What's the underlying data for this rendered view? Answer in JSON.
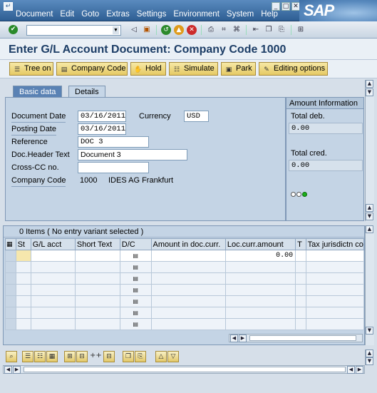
{
  "menubar": {
    "system_icon": "app-menu-icon",
    "items": [
      "Document",
      "Edit",
      "Goto",
      "Extras",
      "Settings",
      "Environment",
      "System",
      "Help"
    ],
    "logo": "SAP"
  },
  "toolbar": {
    "command_value": "",
    "icons": [
      "enter-icon",
      "back-nav-icon",
      "save-icon",
      "back-icon",
      "exit-icon",
      "cancel-icon",
      "print-icon",
      "find-icon",
      "find-next-icon",
      "first-page-icon",
      "create-session-icon",
      "generate-shortcut-icon",
      "layout-menu-icon"
    ]
  },
  "title": "Enter G/L Account Document: Company Code 1000",
  "app_toolbar": {
    "buttons": [
      {
        "label": "Tree on",
        "icon": "tree-icon"
      },
      {
        "label": "Company Code",
        "icon": "company-code-icon"
      },
      {
        "label": "Hold",
        "icon": "hold-icon"
      },
      {
        "label": "Simulate",
        "icon": "simulate-icon"
      },
      {
        "label": "Park",
        "icon": "park-icon"
      },
      {
        "label": "Editing options",
        "icon": "pencil-icon"
      }
    ]
  },
  "tabs": {
    "basic": "Basic data",
    "details": "Details"
  },
  "form": {
    "document_date_label": "Document Date",
    "document_date": "03/16/2011",
    "currency_label": "Currency",
    "currency": "USD",
    "posting_date_label": "Posting Date",
    "posting_date": "03/16/2011",
    "reference_label": "Reference",
    "reference": "DOC 3",
    "header_text_label": "Doc.Header Text",
    "header_text": "Document 3",
    "cross_cc_label": "Cross-CC no.",
    "cross_cc": "",
    "company_code_label": "Company Code",
    "company_code": "1000",
    "company_name": "IDES AG Frankfurt"
  },
  "amount_info": {
    "heading": "Amount Information",
    "total_deb_label": "Total deb.",
    "total_deb": "0.00",
    "total_cred_label": "Total cred.",
    "total_cred": "0.00",
    "status_light": "green"
  },
  "items_table": {
    "title": "0 Items ( No entry variant selected )",
    "columns": [
      "St",
      "G/L acct",
      "Short Text",
      "D/C",
      "Amount in doc.curr.",
      "Loc.curr.amount",
      "T",
      "Tax jurisdictn co"
    ],
    "first_row_loc_amount": "0.00",
    "row_count": 7
  },
  "bottom_toolbar": {
    "icons": [
      "details-icon",
      "select-all-icon",
      "deselect-all-icon",
      "select-block-icon",
      "insert-row-icon",
      "append-row-icon",
      "delete-row-icon",
      "copy-icon",
      "paste-icon",
      "sort-icon",
      "filter-icon"
    ]
  }
}
